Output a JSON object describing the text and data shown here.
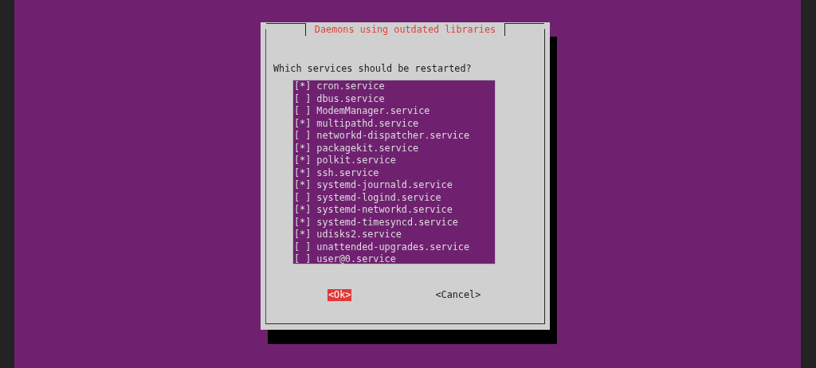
{
  "dialog": {
    "title": "Daemons using outdated libraries",
    "prompt": "Which services should be restarted?",
    "checkbox_on": "[*]",
    "checkbox_off": "[ ]",
    "services": [
      {
        "label": "cron.service",
        "checked": true
      },
      {
        "label": "dbus.service",
        "checked": false
      },
      {
        "label": "ModemManager.service",
        "checked": false
      },
      {
        "label": "multipathd.service",
        "checked": true
      },
      {
        "label": "networkd-dispatcher.service",
        "checked": false
      },
      {
        "label": "packagekit.service",
        "checked": true
      },
      {
        "label": "polkit.service",
        "checked": true
      },
      {
        "label": "ssh.service",
        "checked": true
      },
      {
        "label": "systemd-journald.service",
        "checked": true
      },
      {
        "label": "systemd-logind.service",
        "checked": false
      },
      {
        "label": "systemd-networkd.service",
        "checked": true
      },
      {
        "label": "systemd-timesyncd.service",
        "checked": true
      },
      {
        "label": "udisks2.service",
        "checked": true
      },
      {
        "label": "unattended-upgrades.service",
        "checked": false
      },
      {
        "label": "user@0.service",
        "checked": false
      }
    ],
    "buttons": [
      {
        "label": "<Ok>",
        "selected": true
      },
      {
        "label": "<Cancel>",
        "selected": false
      }
    ]
  }
}
